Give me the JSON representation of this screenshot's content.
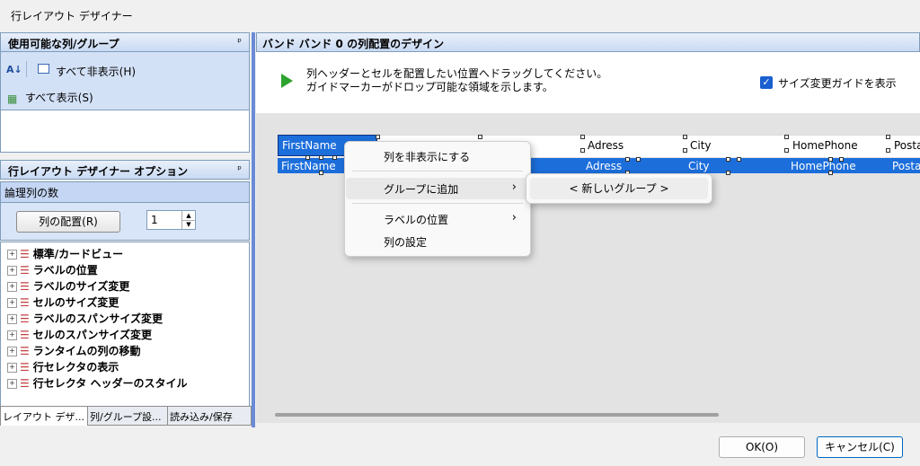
{
  "window": {
    "title": "行レイアウト デザイナー"
  },
  "available": {
    "header": "使用可能な列/グループ",
    "pin": "ᵖ",
    "hide_all": "すべて非表示(H)",
    "show_all": "すべて表示(S)"
  },
  "options": {
    "header": "行レイアウト デザイナー オプション",
    "pin": "ᵖ",
    "logical_columns_label": "論理列の数",
    "arrange_button": "列の配置(R)",
    "spin_value": "1",
    "tree": [
      "標準/カードビュー",
      "ラベルの位置",
      "ラベルのサイズ変更",
      "セルのサイズ変更",
      "ラベルのスパンサイズ変更",
      "セルのスパンサイズ変更",
      "ランタイムの列の移動",
      "行セレクタの表示",
      "行セレクタ ヘッダーのスタイル"
    ]
  },
  "tabs": [
    "レイアウト デザ...",
    "列/グループ設...",
    "読み込み/保存"
  ],
  "band": {
    "header": "バンド バンド 0 の列配置のデザイン",
    "msg1": "列ヘッダーとセルを配置したい位置へドラッグしてください。",
    "msg2": "ガイドマーカーがドロップ可能な領域を示します。",
    "guide_label": "サイズ変更ガイドを表示",
    "guide_checked": true
  },
  "columns": [
    "FirstName",
    "Adress",
    "City",
    "HomePhone",
    "Posta"
  ],
  "context_menu": {
    "items": [
      "列を非表示にする",
      "グループに追加",
      "ラベルの位置",
      "列の設定"
    ],
    "submenu_item": "< 新しいグループ >"
  },
  "footer": {
    "ok": "OK(O)",
    "cancel": "キャンセル(C)"
  },
  "colors": {
    "accent": "#1c6edb",
    "panel": "#d3e1f7"
  }
}
